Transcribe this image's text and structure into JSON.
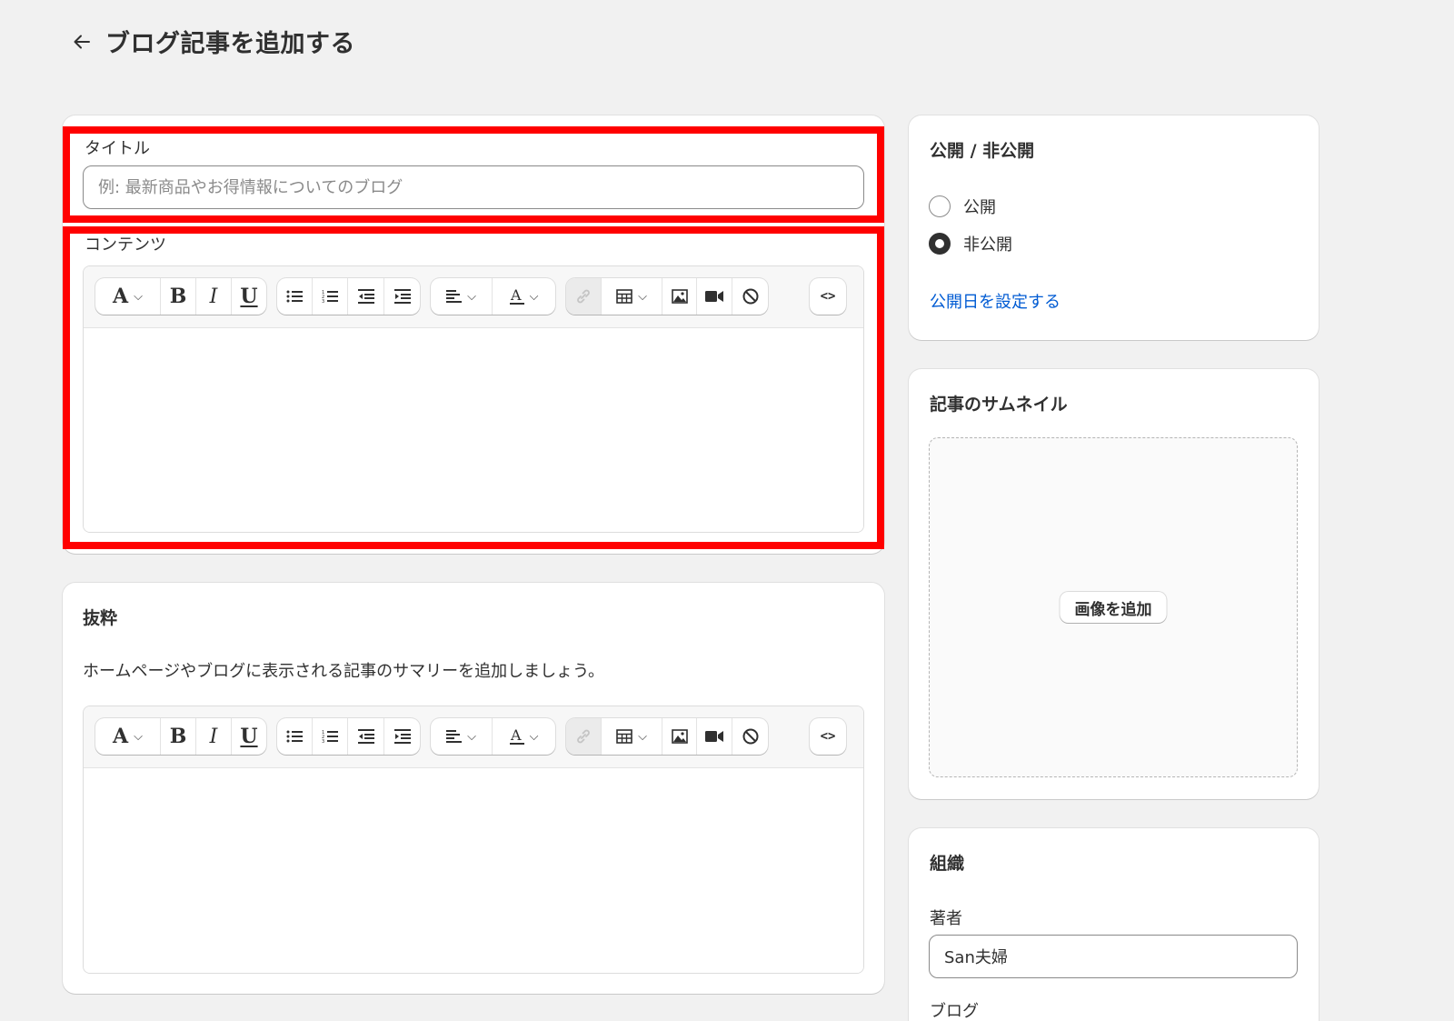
{
  "header": {
    "back_icon": "arrow-left-icon",
    "title": "ブログ記事を追加する"
  },
  "main": {
    "title_label": "タイトル",
    "title_placeholder": "例: 最新商品やお得情報についてのブログ",
    "title_value": "",
    "content_label": "コンテンツ",
    "content_value": ""
  },
  "excerpt": {
    "heading": "抜粋",
    "description": "ホームページやブログに表示される記事のサマリーを追加しましょう。",
    "value": ""
  },
  "toolbar": {
    "font_glyph": "A",
    "bold_glyph": "B",
    "italic_glyph": "I",
    "underline_glyph": "U",
    "code_glyph": "<>",
    "icons": [
      "text-style-icon",
      "bold-icon",
      "italic-icon",
      "underline-icon",
      "bullet-list-icon",
      "numbered-list-icon",
      "outdent-icon",
      "indent-icon",
      "align-icon",
      "text-color-icon",
      "link-icon",
      "table-icon",
      "image-icon",
      "video-icon",
      "clear-format-icon",
      "code-icon"
    ]
  },
  "visibility": {
    "heading": "公開 / 非公開",
    "options": [
      {
        "label": "公開",
        "checked": false
      },
      {
        "label": "非公開",
        "checked": true
      }
    ],
    "set_date_link": "公開日を設定する"
  },
  "thumbnail": {
    "heading": "記事のサムネイル",
    "add_image_label": "画像を追加"
  },
  "organization": {
    "heading": "組織",
    "author_label": "著者",
    "author_value": "San夫婦",
    "blog_label": "ブログ"
  },
  "colors": {
    "highlight": "#ff0000",
    "link": "#005bd3",
    "background": "#f1f1f1"
  }
}
